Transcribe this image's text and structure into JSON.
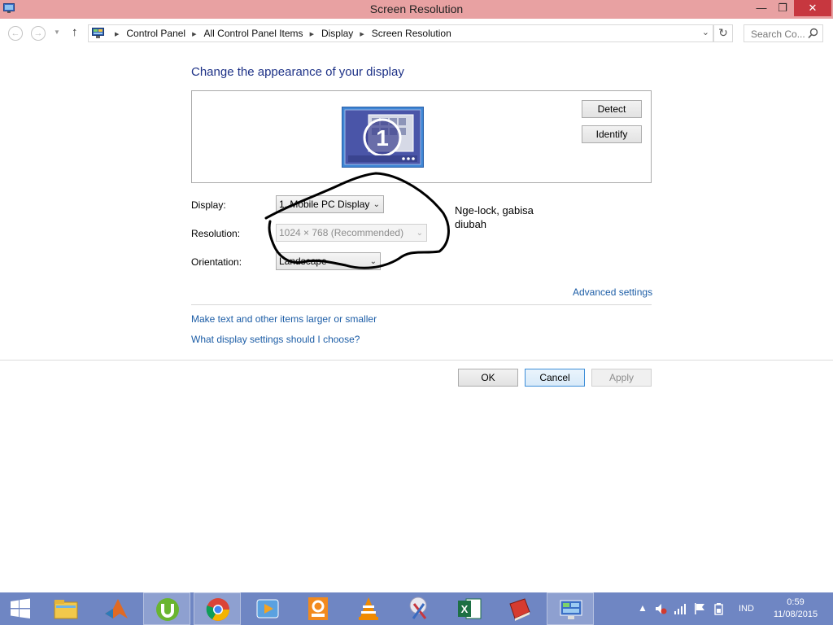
{
  "window": {
    "title": "Screen Resolution",
    "min_glyph": "—",
    "max_glyph": "❐",
    "close_glyph": "✕"
  },
  "nav": {
    "breadcrumb": [
      "Control Panel",
      "All Control Panel Items",
      "Display",
      "Screen Resolution"
    ],
    "search_placeholder": "Search Co..."
  },
  "content": {
    "heading": "Change the appearance of your display",
    "monitor_number": "1",
    "detect_label": "Detect",
    "identify_label": "Identify",
    "display_label": "Display:",
    "display_value": "1. Mobile PC Display",
    "resolution_label": "Resolution:",
    "resolution_value": "1024 × 768 (Recommended)",
    "orientation_label": "Orientation:",
    "orientation_value": "Landscape",
    "advanced_link": "Advanced settings",
    "link_text_size": "Make text and other items larger or smaller",
    "link_display_help": "What display settings should I choose?"
  },
  "annotation": {
    "text": "Nge-lock, gabisa diubah",
    "color": "#000000"
  },
  "footer": {
    "ok_label": "OK",
    "cancel_label": "Cancel",
    "apply_label": "Apply"
  },
  "taskbar": {
    "color": "#6f86c3",
    "apps": [
      "start-icon",
      "file-explorer-icon",
      "matlab-icon",
      "utorrent-icon",
      "chrome-icon",
      "media-player-icon",
      "pdf-reader-icon",
      "vlc-icon",
      "snipping-tool-icon",
      "excel-icon",
      "book-icon",
      "control-panel-icon"
    ],
    "tray": {
      "language": "IND",
      "time": "0:59",
      "date": "11/08/2015"
    }
  },
  "colors": {
    "titlebar": "#e8a1a2",
    "close_button": "#c7373f",
    "heading": "#1e3287",
    "link": "#1c5da6"
  }
}
